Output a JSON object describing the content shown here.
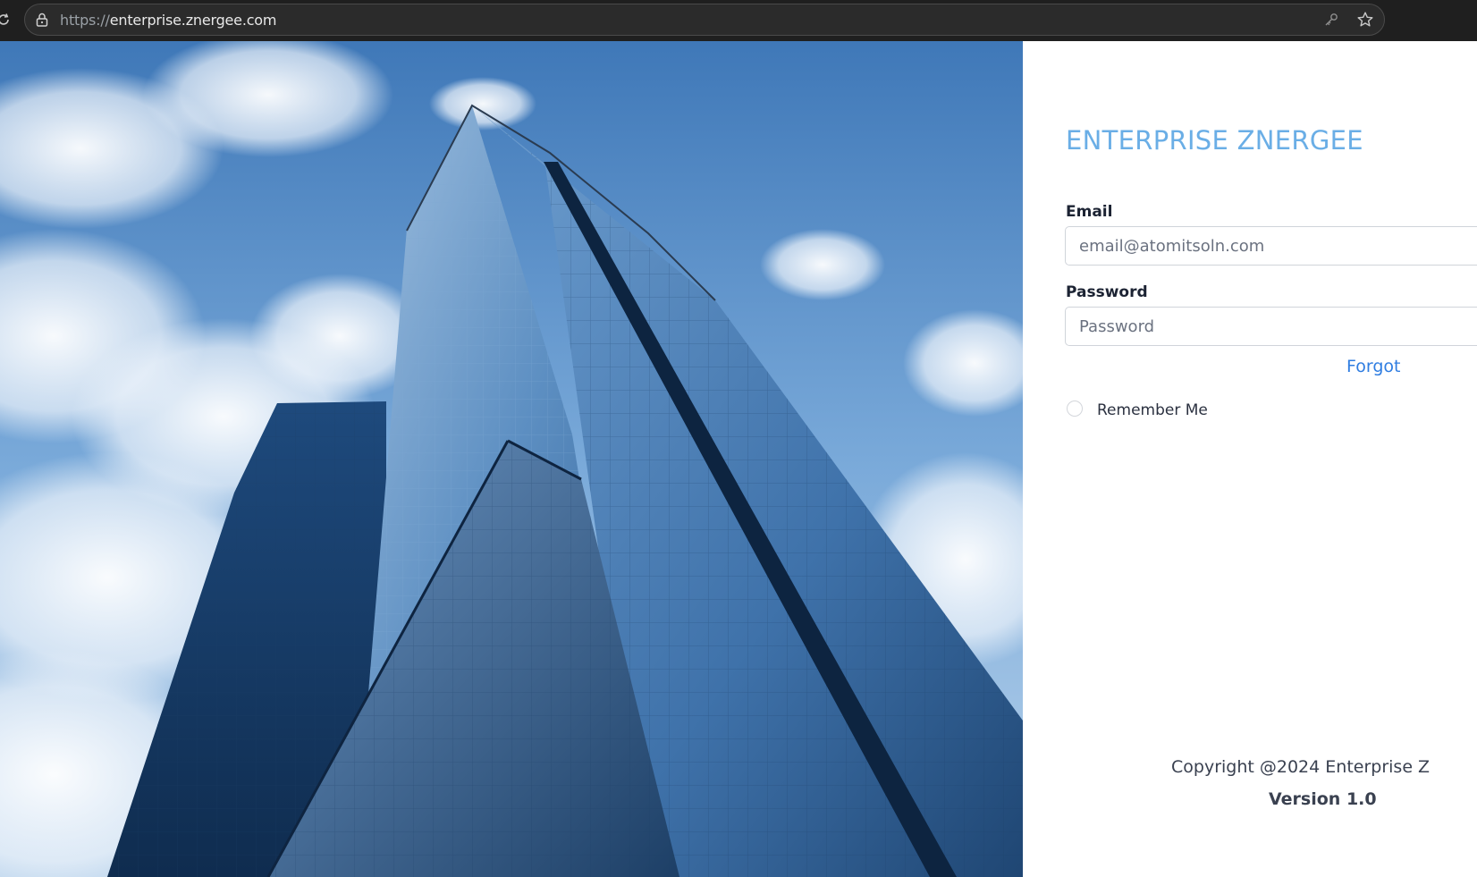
{
  "browser": {
    "url_scheme": "https://",
    "url_host": "enterprise.znergee.com",
    "icons": [
      "reload-icon",
      "lock-icon",
      "key-icon",
      "star-icon"
    ]
  },
  "hero": {
    "description_icon": "building-photo"
  },
  "login": {
    "brand_title": "ENTERPRISE ZNERGEE",
    "email_label": "Email",
    "email_placeholder": "email@atomitsoln.com",
    "email_value": "",
    "password_label": "Password",
    "password_placeholder": "Password",
    "password_value": "",
    "forgot_label": "Forgot",
    "remember_label": "Remember Me",
    "remember_checked": false
  },
  "footer": {
    "copyright": "Copyright @2024 Enterprise Z",
    "version": "Version 1.0"
  },
  "colors": {
    "brand": "#6aaee6",
    "link": "#2f7de1",
    "chrome_bg": "#1f1f1f"
  }
}
